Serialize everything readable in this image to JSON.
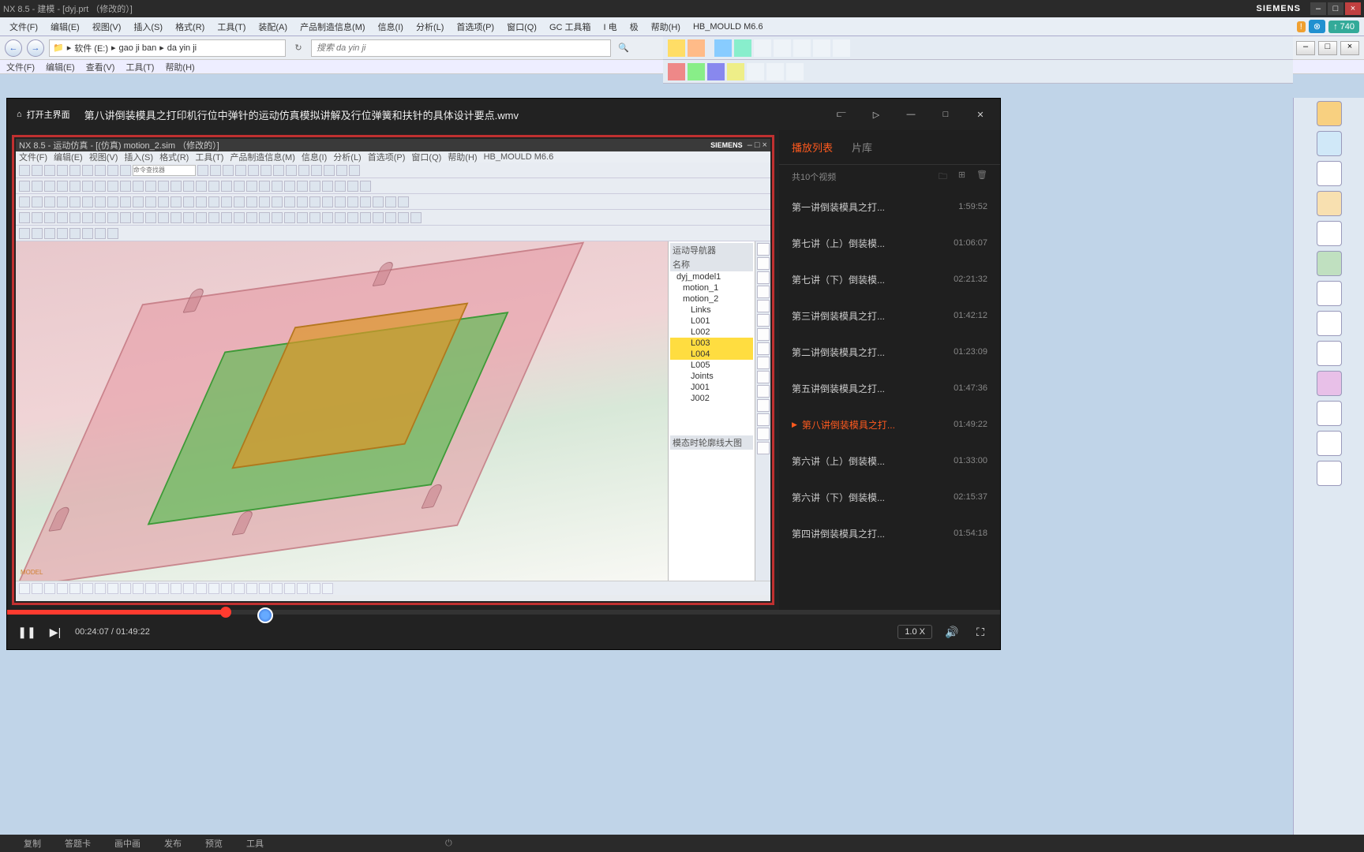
{
  "nx": {
    "title": "NX 8.5 - 建模 - [dyj.prt （修改的）]",
    "brand": "SIEMENS",
    "menu": [
      "文件(F)",
      "编辑(E)",
      "视图(V)",
      "插入(S)",
      "格式(R)",
      "工具(T)",
      "装配(A)",
      "产品制造信息(M)",
      "信息(I)",
      "分析(L)",
      "首选项(P)",
      "窗口(Q)",
      "GC 工具箱",
      "I 电",
      "极",
      "帮助(H)",
      "HB_MOULD M6.6"
    ],
    "badge_num": "↑ 740"
  },
  "explorer": {
    "path": [
      "软件 (E:)",
      "gao ji ban",
      "da yin ji"
    ],
    "search_placeholder": "搜索 da yin ji",
    "sec_menu": [
      "文件(F)",
      "编辑(E)",
      "查看(V)",
      "工具(T)",
      "帮助(H)"
    ]
  },
  "player": {
    "home": "打开主界面",
    "title": "第八讲倒装模具之打印机行位中弹针的运动仿真模拟讲解及行位弹簧和扶针的具体设计要点.wmv",
    "progress_pct": 22,
    "cursor_pct": 26,
    "time_cur": "00:24:07",
    "time_tot": "01:49:22",
    "rate": "1.0 X"
  },
  "playlist": {
    "tab_list": "播放列表",
    "tab_lib": "片库",
    "count": "共10个视频",
    "items": [
      {
        "name": "第一讲倒装模具之打...",
        "dur": "1:59:52",
        "active": false
      },
      {
        "name": "第七讲（上）倒装模...",
        "dur": "01:06:07",
        "active": false
      },
      {
        "name": "第七讲（下）倒装模...",
        "dur": "02:21:32",
        "active": false
      },
      {
        "name": "第三讲倒装模具之打...",
        "dur": "01:42:12",
        "active": false
      },
      {
        "name": "第二讲倒装模具之打...",
        "dur": "01:23:09",
        "active": false
      },
      {
        "name": "第五讲倒装模具之打...",
        "dur": "01:47:36",
        "active": false
      },
      {
        "name": "第八讲倒装模具之打...",
        "dur": "01:49:22",
        "active": true
      },
      {
        "name": "第六讲（上）倒装模...",
        "dur": "01:33:00",
        "active": false
      },
      {
        "name": "第六讲（下）倒装模...",
        "dur": "02:15:37",
        "active": false
      },
      {
        "name": "第四讲倒装模具之打...",
        "dur": "01:54:18",
        "active": false
      }
    ]
  },
  "inner_nx": {
    "title": "NX 8.5 - 运动仿真 - [(仿真) motion_2.sim （修改的）]",
    "menu": [
      "文件(F)",
      "编辑(E)",
      "视图(V)",
      "插入(S)",
      "格式(R)",
      "工具(T)",
      "产品制造信息(M)",
      "信息(I)",
      "分析(L)",
      "首选项(P)",
      "窗口(Q)",
      "帮助(H)",
      "HB_MOULD M6.6"
    ],
    "cmd_label": "命令查找器",
    "tree_header": "运动导航器",
    "tree_col": "名称",
    "tree": {
      "root": "dyj_model1",
      "m1": "motion_1",
      "m2": "motion_2",
      "links": "Links",
      "l1": "L001",
      "l2": "L002",
      "l3": "L003",
      "l4": "L004",
      "l5": "L005",
      "joints": "Joints",
      "j1": "J001",
      "j2": "J002"
    },
    "view_label": "模态时轮廓线大图"
  },
  "bottom": {
    "items": [
      "复制",
      "答题卡",
      "画中画",
      "发布",
      "预览",
      "工具"
    ]
  }
}
